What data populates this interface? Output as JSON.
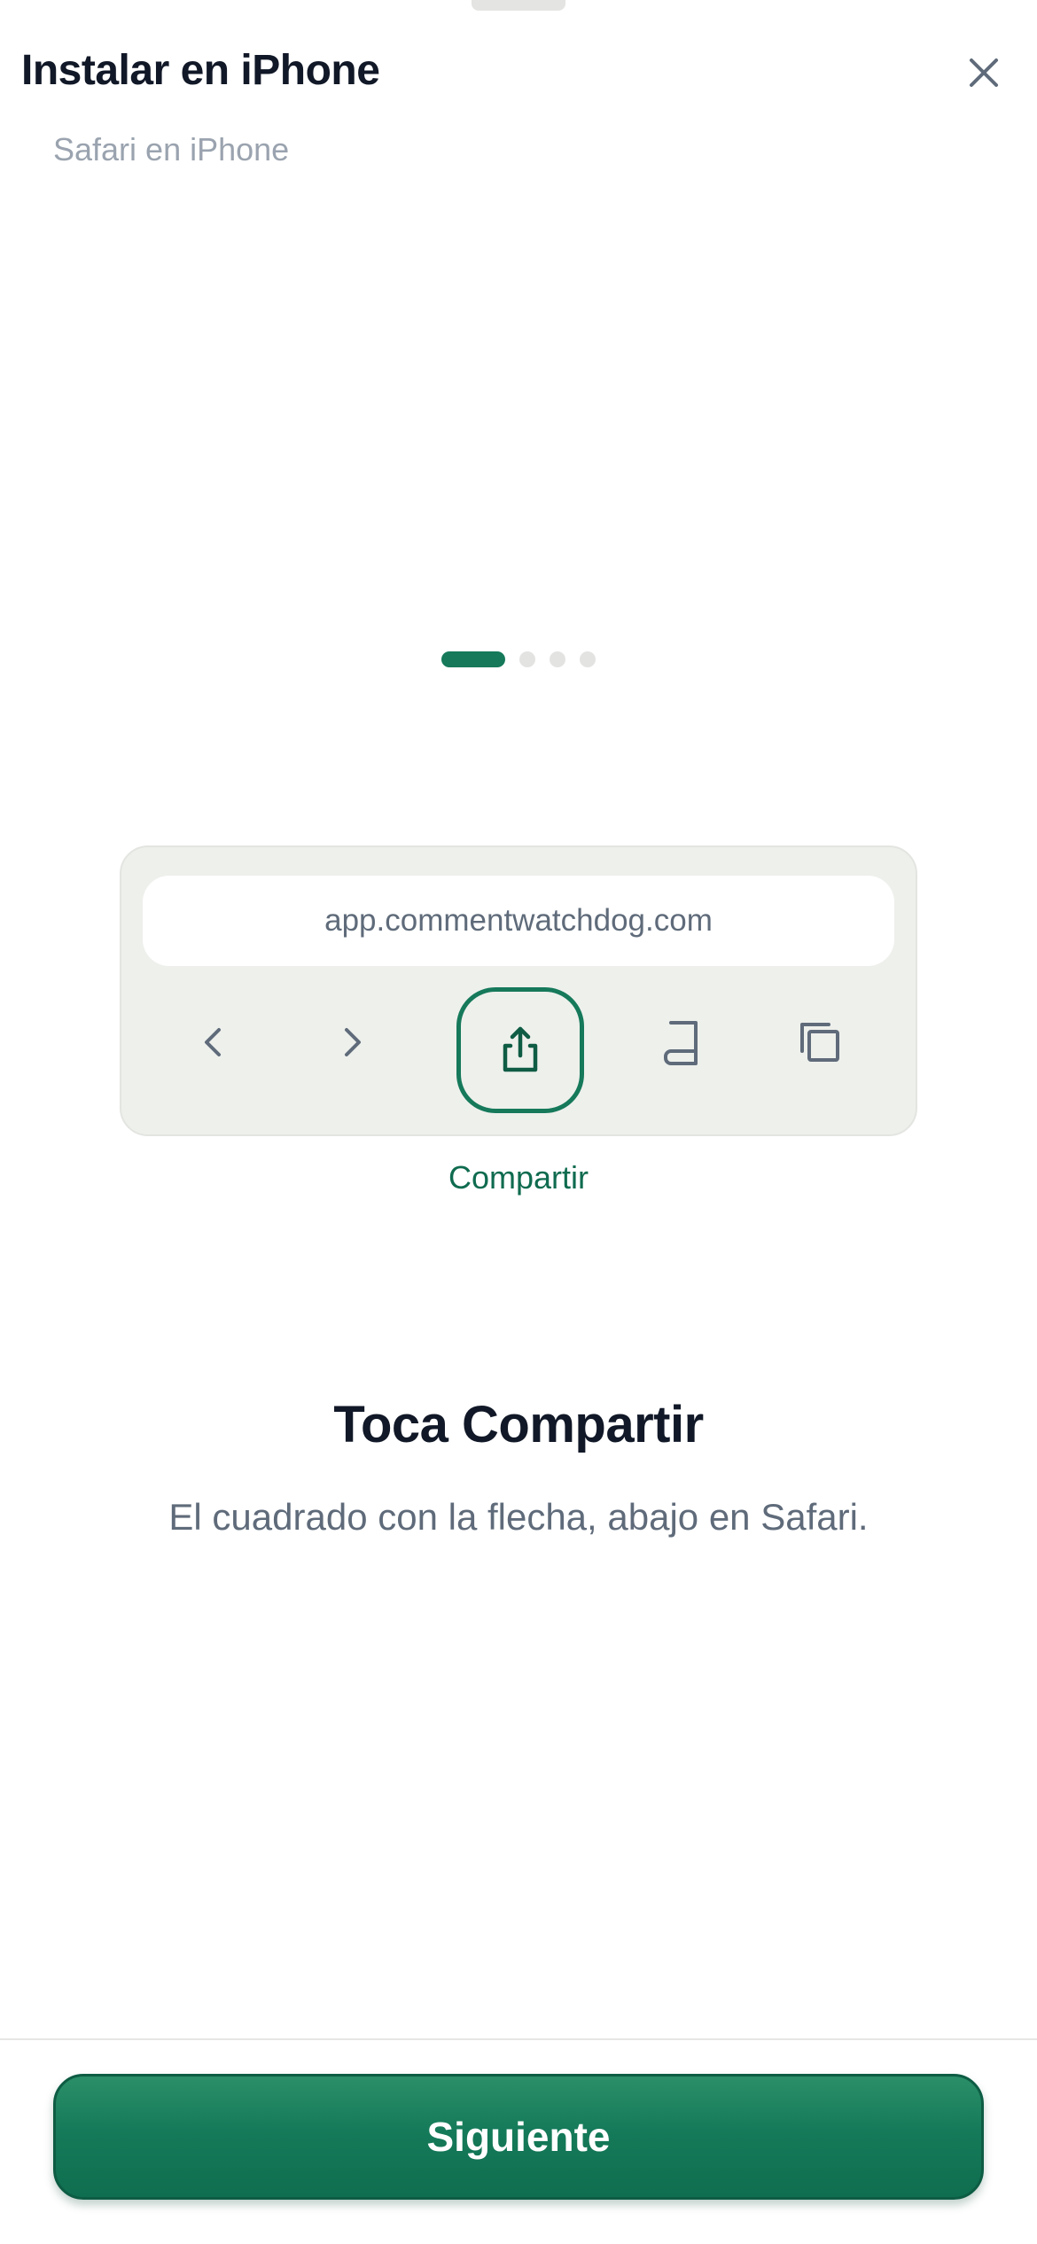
{
  "header": {
    "title": "Instalar en iPhone",
    "subtitle": "Safari en iPhone",
    "close_icon": "close-icon"
  },
  "pagination": {
    "total_steps": 4,
    "current_step": 1
  },
  "browser_mock": {
    "url": "app.commentwatchdog.com",
    "toolbar_icons": [
      "chevron-left-icon",
      "chevron-right-icon",
      "share-icon",
      "bookmarks-icon",
      "tabs-icon"
    ],
    "highlighted_label": "Compartir"
  },
  "step": {
    "title": "Toca Compartir",
    "description": "El cuadrado con la flecha, abajo en Safari."
  },
  "footer": {
    "next_label": "Siguiente"
  },
  "colors": {
    "accent": "#15795a",
    "accent_dark": "#0f6b4f",
    "card_bg": "#eef0ec",
    "text_primary": "#111827",
    "text_secondary": "#5f6b7a",
    "text_muted": "#9aa3af"
  }
}
